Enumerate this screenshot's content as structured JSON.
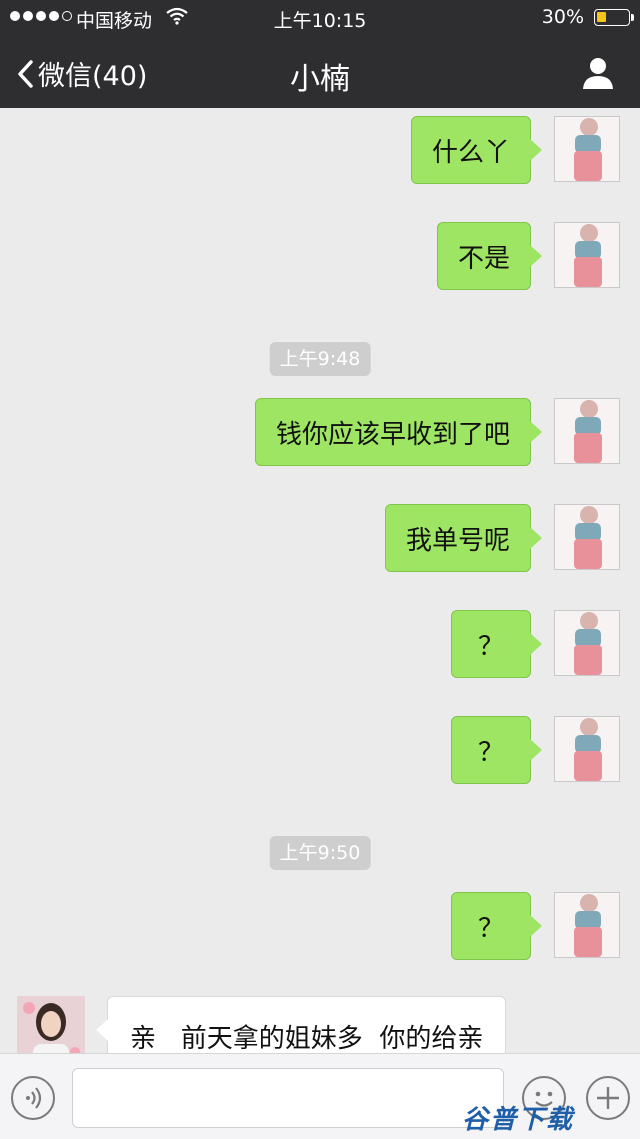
{
  "status_bar": {
    "carrier": "中国移动",
    "time": "上午10:15",
    "battery_percent": "30%",
    "battery_level": 0.3,
    "signal_bars": 4
  },
  "nav": {
    "back_label": "微信(40)",
    "title": "小楠",
    "profile_icon": "person-icon"
  },
  "messages": [
    {
      "type": "out",
      "text": "什么丫"
    },
    {
      "type": "out",
      "text": "不是"
    },
    {
      "type": "time",
      "text": "上午9:48"
    },
    {
      "type": "out",
      "text": "钱你应该早收到了吧"
    },
    {
      "type": "out",
      "text": "我单号呢"
    },
    {
      "type": "out",
      "text": "？"
    },
    {
      "type": "out",
      "text": "？"
    },
    {
      "type": "time",
      "text": "上午9:50"
    },
    {
      "type": "out",
      "text": "？"
    },
    {
      "type": "in",
      "text": "亲   前天拿的姐妹多  你的给亲"
    }
  ],
  "input_bar": {
    "voice_icon": "voice-icon",
    "emoji_icon": "emoji-icon",
    "plus_icon": "plus-icon",
    "watermark": "谷普下载"
  },
  "colors": {
    "nav_bg": "#2e2e31",
    "chat_bg": "#ebebeb",
    "bubble_out": "#9ee564",
    "bubble_in": "#ffffff"
  }
}
